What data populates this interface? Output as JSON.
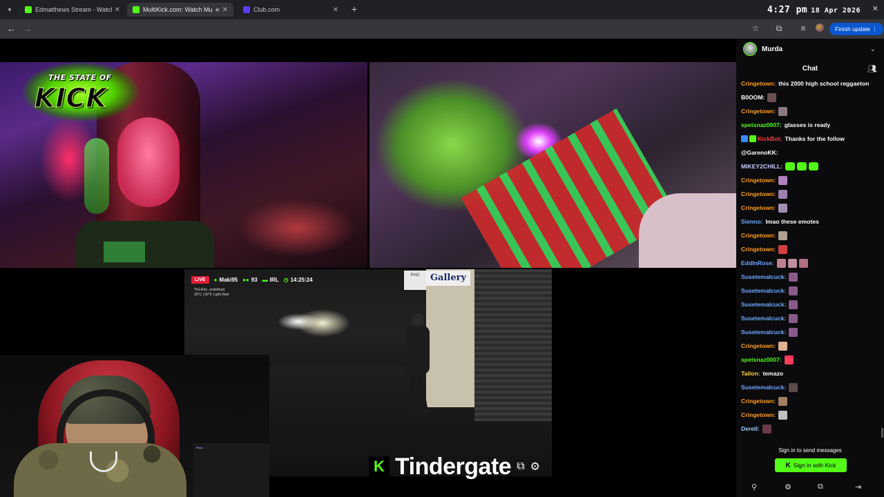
{
  "browser": {
    "tabs": [
      {
        "title": "Edmatthews Stream - Watch Li",
        "favicon_color": "#53fc18",
        "active": false
      },
      {
        "title": "MultiKick.com: Watch Multi",
        "favicon_color": "#53fc18",
        "active": true
      },
      {
        "title": "Club.com",
        "favicon_color": "#5b3cff",
        "active": false
      }
    ],
    "clock_time": "4:27 pm",
    "clock_date": "18 Apr 2026",
    "finish_update_label": "Finish update"
  },
  "overlay": {
    "logo_top": "THE STATE OF",
    "logo_main": "KICK"
  },
  "stream_overlay": {
    "live_label": "LIVE",
    "user": "Maki95",
    "viewers": "93",
    "category": "IRL",
    "uptime": "14:25:24",
    "weather_line1": "Thủ Đức, undefined",
    "weather_line2": "33°C | 92°F, Light Rain"
  },
  "branding": {
    "k_mark": "K",
    "name": "Tindergate"
  },
  "webcam_screen_text": "Picco",
  "sidebar": {
    "username": "Murda",
    "chat_title": "Chat",
    "sign_in_note": "Sign in to send messages",
    "sign_in_button": "Sign in with Kick",
    "colors": {
      "accent": "#53fc18",
      "background": "#0b0b0d"
    }
  },
  "chat": [
    {
      "user": "Cringetown",
      "color": "#ff9e1b",
      "message": "this 2000 high school reggaeton",
      "emotes": []
    },
    {
      "user": "B0OOM",
      "color": "#ffffff",
      "message": "",
      "emotes": [
        "#6a5050"
      ]
    },
    {
      "user": "Cringetown",
      "color": "#ff9e1b",
      "message": "",
      "emotes": [
        "#8a7a80"
      ]
    },
    {
      "user": "spetsnaz0007",
      "color": "#53fc18",
      "message": "glasses is ready",
      "emotes": []
    },
    {
      "user": "KickBot",
      "color": "#ff3b3b",
      "message": "Thanks for the follow",
      "emotes": [],
      "badges": [
        "#3b8cff",
        "#53fc18"
      ]
    },
    {
      "user": "@GarenoKK",
      "color": "#ffffff",
      "message": "",
      "emotes": []
    },
    {
      "user": "MIKEY2CHILL",
      "color": "#c9c9ff",
      "message": "",
      "emotes": [],
      "kick_emotes": 3
    },
    {
      "user": "Cringetown",
      "color": "#ff9e1b",
      "message": "",
      "emotes": [
        "#b080c0"
      ]
    },
    {
      "user": "Cringetown",
      "color": "#ff9e1b",
      "message": "",
      "emotes": [
        "#9c80b0"
      ]
    },
    {
      "user": "Cringetown",
      "color": "#ff9e1b",
      "message": "",
      "emotes": [
        "#a090b0"
      ]
    },
    {
      "user": "Sienno",
      "color": "#6fa8ff",
      "message": "lmao these emotes",
      "emotes": []
    },
    {
      "user": "Cringetown",
      "color": "#ff9e1b",
      "message": "",
      "emotes": [
        "#b0a090"
      ]
    },
    {
      "user": "Cringetown",
      "color": "#ff9e1b",
      "message": "",
      "emotes": [
        "#d04040"
      ]
    },
    {
      "user": "EddInRose",
      "color": "#6fa8ff",
      "message": "",
      "emotes": [
        "#c08090",
        "#c090a0",
        "#b07080"
      ]
    },
    {
      "user": "Susetemalcuck",
      "color": "#6fa8ff",
      "message": "",
      "emotes": [
        "#8a5a8a"
      ]
    },
    {
      "user": "Susetemalcuck",
      "color": "#6fa8ff",
      "message": "",
      "emotes": [
        "#8a5a8a"
      ]
    },
    {
      "user": "Susetemalcuck",
      "color": "#6fa8ff",
      "message": "",
      "emotes": [
        "#8a5a8a"
      ]
    },
    {
      "user": "Susetemalcuck",
      "color": "#6fa8ff",
      "message": "",
      "emotes": [
        "#8a5a8a"
      ]
    },
    {
      "user": "Susetemalcuck",
      "color": "#6fa8ff",
      "message": "",
      "emotes": [
        "#8a5a8a"
      ]
    },
    {
      "user": "Cringetown",
      "color": "#ff9e1b",
      "message": "",
      "emotes": [
        "#e0b090"
      ]
    },
    {
      "user": "spetsnaz0007",
      "color": "#53fc18",
      "message": "",
      "emotes": [
        "#ff3b5c"
      ]
    },
    {
      "user": "Tailon",
      "color": "#ffd23b",
      "message": "temazo",
      "emotes": []
    },
    {
      "user": "Susetemalcuck",
      "color": "#6fa8ff",
      "message": "",
      "emotes": [
        "#5a4a4a"
      ]
    },
    {
      "user": "Cringetown",
      "color": "#ff9e1b",
      "message": "",
      "emotes": [
        "#a08060"
      ]
    },
    {
      "user": "Cringetown",
      "color": "#ff9e1b",
      "message": "",
      "emotes": [
        "#c0c0c0"
      ]
    },
    {
      "user": "Derell",
      "color": "#9ad0ff",
      "message": "",
      "emotes": [
        "#6a3a4a"
      ]
    }
  ]
}
